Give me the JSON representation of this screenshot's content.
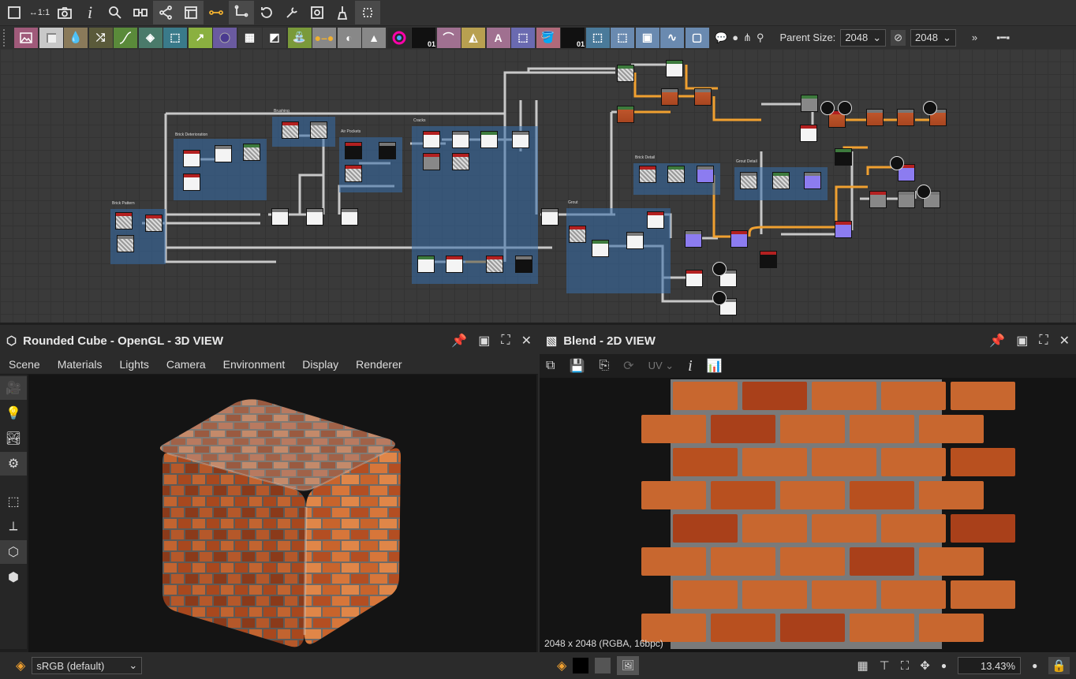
{
  "toolbar_top": {
    "icons": [
      "frame-icon",
      "one-to-one-icon",
      "camera-icon",
      "info-icon",
      "search-icon",
      "node-link-icon",
      "share-icon",
      "window-icon",
      "connector-icon",
      "path-icon",
      "history-icon",
      "wrench-icon",
      "bake-icon",
      "broom-icon",
      "grid-align-icon"
    ]
  },
  "toolbar_nodes": {
    "parent_size_label": "Parent Size:",
    "parent_size_value": "2048",
    "output_size_value": "2048",
    "tile_texts": {
      "grayscale_01": "01",
      "text_A": "A",
      "bitmap_01": "01"
    },
    "colors": {
      "image": "#b05a7a",
      "blend": "#c0c0c0",
      "fx": "#8a7a5a",
      "warp": "#5a7a3a",
      "curve": "#6aa83a",
      "gradient": "#4a8a6a",
      "transform": "#3a6a9a",
      "uv": "#a0c060",
      "shape": "#8a5aa0"
    }
  },
  "graph": {
    "frames": {
      "brushing": "Brushing",
      "brick_deterioration": "Brick Deterioration",
      "air_pockets": "Air Pockets",
      "cracks": "Cracks",
      "brick_pattern": "Brick Pattern",
      "grout": "Grout",
      "brick_detail": "Brick Detail",
      "grout_detail": "Grout Detail"
    }
  },
  "view3d": {
    "title": "Rounded Cube - OpenGL - 3D VIEW",
    "menu": [
      "Scene",
      "Materials",
      "Lights",
      "Camera",
      "Environment",
      "Display",
      "Renderer"
    ],
    "colorspace": "sRGB (default)"
  },
  "view2d": {
    "title": "Blend - 2D VIEW",
    "uv_label": "UV",
    "resolution": "2048 x 2048 (RGBA, 16bpc)",
    "zoom": "13.43%"
  },
  "brick_colors": {
    "brick": "#c8672f",
    "brick_dark": "#a9401a",
    "grout": "#6e6e6e"
  }
}
